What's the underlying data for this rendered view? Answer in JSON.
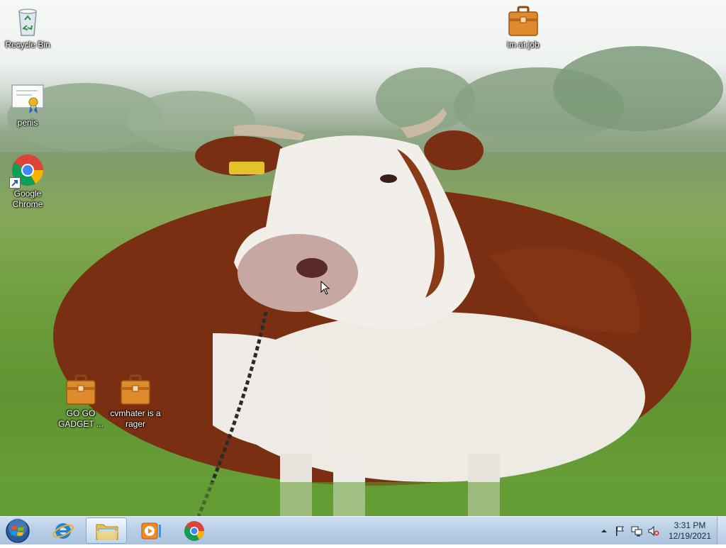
{
  "desktop": {
    "icons": [
      {
        "label": "Recycle Bin",
        "icon": "recycle-bin-icon"
      },
      {
        "label": "penis",
        "icon": "certificate-icon"
      },
      {
        "label": "Google Chrome",
        "icon": "chrome-icon"
      },
      {
        "label": "im at job",
        "icon": "briefcase-icon"
      },
      {
        "label": "GO GO GADGET ...",
        "icon": "briefcase-icon"
      },
      {
        "label": "cvmhater is a rager",
        "icon": "briefcase-icon"
      }
    ]
  },
  "taskbar": {
    "start_icon": "windows-start-orb-icon",
    "pinned": [
      {
        "name": "Internet Explorer",
        "icon": "internet-explorer-icon"
      },
      {
        "name": "Windows Explorer",
        "icon": "folder-icon"
      },
      {
        "name": "Windows Media Player",
        "icon": "media-player-icon"
      },
      {
        "name": "Google Chrome",
        "icon": "chrome-icon"
      }
    ],
    "tray": {
      "icons": [
        "show-hidden-icons-arrow",
        "action-center-flag-icon",
        "network-icon",
        "volume-muted-icon"
      ],
      "time": "3:31 PM",
      "date": "12/19/2021"
    }
  },
  "colors": {
    "taskbar_top": "#cfe0f2",
    "taskbar_bottom": "#a9c2de",
    "cow_brown": "#7a2f12",
    "cow_white": "#f2efea",
    "grass": "#6aa23a"
  }
}
